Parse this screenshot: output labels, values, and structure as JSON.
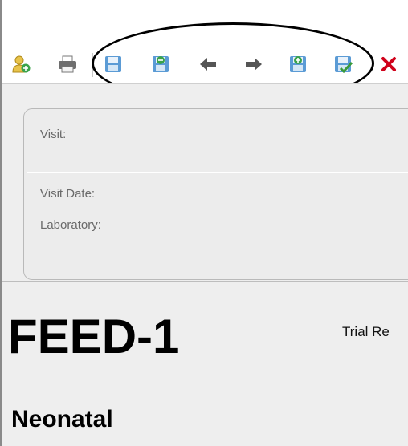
{
  "toolbar": {
    "icons": [
      "add-patient-icon",
      "print-icon",
      "save-icon",
      "delete-record-icon",
      "previous-arrow-icon",
      "next-arrow-icon",
      "add-record-icon",
      "save-and-check-icon",
      "close-icon"
    ],
    "colors": {
      "floppy": "#5b9bd5",
      "arrow": "#555555",
      "close": "#d0021b",
      "check": "#3a9a3a"
    }
  },
  "card": {
    "visit_label": "Visit:",
    "visit_date_label": "Visit Date:",
    "laboratory_label": "Laboratory:"
  },
  "form": {
    "code": "FEED-1",
    "trial_text": "Trial Re",
    "section_title": "Neonatal"
  }
}
